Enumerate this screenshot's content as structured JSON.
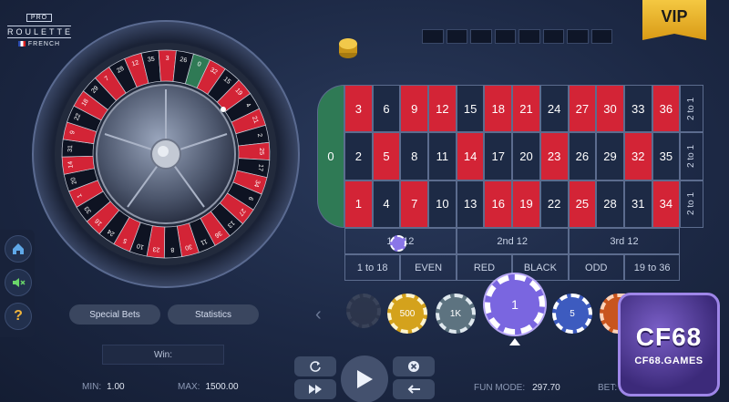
{
  "logo": {
    "badge": "PRO",
    "title": "ROULETTE",
    "variant": "FRENCH"
  },
  "vip_label": "VIP",
  "wheel": {
    "numbers": [
      0,
      32,
      15,
      19,
      4,
      21,
      2,
      25,
      17,
      34,
      6,
      27,
      13,
      36,
      11,
      30,
      8,
      23,
      10,
      5,
      24,
      16,
      33,
      1,
      20,
      14,
      31,
      9,
      22,
      18,
      29,
      7,
      28,
      12,
      35,
      3,
      26
    ],
    "red": [
      1,
      3,
      5,
      7,
      9,
      12,
      14,
      16,
      18,
      19,
      21,
      23,
      25,
      27,
      30,
      32,
      34,
      36
    ]
  },
  "table": {
    "zero": "0",
    "rows": [
      [
        3,
        6,
        9,
        12,
        15,
        18,
        21,
        24,
        27,
        30,
        33,
        36
      ],
      [
        2,
        5,
        8,
        11,
        14,
        17,
        20,
        23,
        26,
        29,
        32,
        35
      ],
      [
        1,
        4,
        7,
        10,
        13,
        16,
        19,
        22,
        25,
        28,
        31,
        34
      ]
    ],
    "columns": [
      "2 to 1",
      "2 to 1",
      "2 to 1"
    ],
    "dozens": [
      "1st 12",
      "2nd 12",
      "3rd 12"
    ],
    "outside": [
      "1 to 18",
      "EVEN",
      "RED",
      "BLACK",
      "ODD",
      "19 to 36"
    ]
  },
  "buttons": {
    "special_bets": "Special Bets",
    "statistics": "Statistics"
  },
  "win_label": "Win:",
  "limits": {
    "min_label": "MIN:",
    "min_value": "1.00",
    "max_label": "MAX:",
    "max_value": "1500.00"
  },
  "chips": [
    {
      "label": "",
      "color": "#3a3f4f"
    },
    {
      "label": "500",
      "color": "#d4a21c"
    },
    {
      "label": "1K",
      "color": "#5d7380"
    },
    {
      "label": "1",
      "color": "#7a66e0"
    },
    {
      "label": "5",
      "color": "#3d5bbf"
    },
    {
      "label": "",
      "color": "#c8551e"
    }
  ],
  "fun_mode": {
    "label": "FUN MODE:",
    "value": "297.70"
  },
  "bet_label": "BET:",
  "watermark": {
    "big": "CF68",
    "small": "CF68.GAMES"
  },
  "colors": {
    "red": "#d32436",
    "black": "#1d2a45",
    "green": "#2f7a55",
    "gold": "#f4c842"
  }
}
